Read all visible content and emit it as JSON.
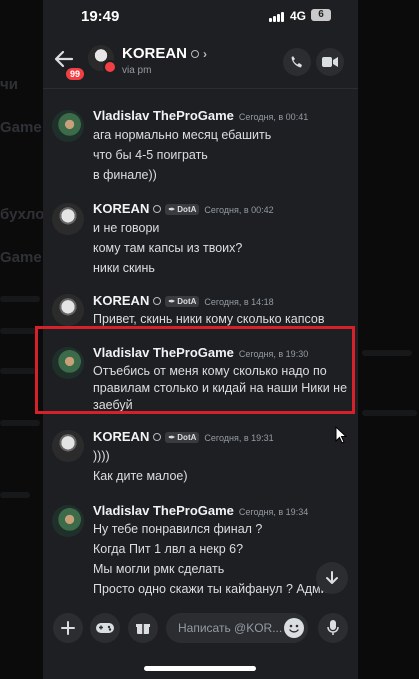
{
  "status_bar": {
    "time": "19:49",
    "network": "4G",
    "battery": "6"
  },
  "header": {
    "unread_count": "99",
    "name": "KOREAN",
    "subtitle": "via pm"
  },
  "background_fragments": [
    "чи",
    "Game",
    "бухло",
    "Game"
  ],
  "messages": [
    {
      "author": "Vladislav TheProGame",
      "timestamp": "Сегодня, в 00:41",
      "lines": [
        "ага нормально месяц ебашить",
        "что бы 4-5 поиграть",
        "в финале))"
      ]
    },
    {
      "author": "KOREAN",
      "tag": "DotA",
      "timestamp": "Сегодня, в 00:42",
      "lines": [
        "и не говори",
        "кому там капсы из твоих?",
        "ники скинь"
      ]
    },
    {
      "author": "KOREAN",
      "tag": "DotA",
      "timestamp": "Сегодня, в 14:18",
      "lines": [
        "Привет, скинь ники кому сколько капсов"
      ]
    },
    {
      "author": "Vladislav TheProGame",
      "timestamp": "Сегодня, в 19:30",
      "lines": [
        "Отъебись от меня кому сколько надо по",
        "правилам столько и кидай на наши Ники не",
        "заебуй"
      ]
    },
    {
      "author": "KOREAN",
      "tag": "DotA",
      "timestamp": "Сегодня, в 19:31",
      "lines": [
        "))))",
        "Как дите малое)"
      ]
    },
    {
      "author": "Vladislav TheProGame",
      "timestamp": "Сегодня, в 19:34",
      "lines": [
        "Ну тебе понравился финал ?",
        "Когда Пит 1 лвл а некр 6?",
        "Мы могли рмк сделать",
        "Просто одно скажи ты кайфанул ? Админ"
      ]
    }
  ],
  "composer": {
    "placeholder": "Написать @KOR..."
  },
  "icons": [
    "back-arrow-icon",
    "gear-icon",
    "chevron-right-icon",
    "phone-call-icon",
    "video-call-icon",
    "plus-icon",
    "gamepad-icon",
    "gift-icon",
    "emoji-icon",
    "microphone-icon",
    "arrow-down-icon",
    "mouse-cursor-icon"
  ],
  "colors": {
    "background": "#1e1f22",
    "accent_red": "#f23f43",
    "highlight_box": "#d6202a"
  }
}
